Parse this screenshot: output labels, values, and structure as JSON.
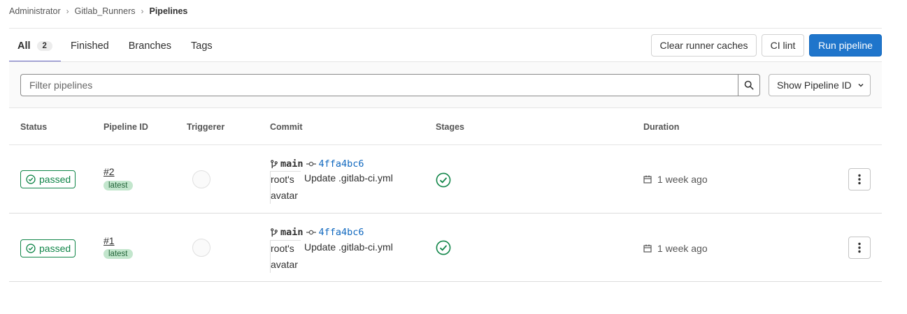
{
  "breadcrumb": [
    "Administrator",
    "Gitlab_Runners",
    "Pipelines"
  ],
  "tabs": [
    {
      "label": "All",
      "count": "2"
    },
    {
      "label": "Finished"
    },
    {
      "label": "Branches"
    },
    {
      "label": "Tags"
    }
  ],
  "buttons": {
    "clear_caches": "Clear runner caches",
    "ci_lint": "CI lint",
    "run_pipeline": "Run pipeline"
  },
  "filter": {
    "placeholder": "Filter pipelines",
    "show_label": "Show Pipeline ID"
  },
  "columns": [
    "Status",
    "Pipeline ID",
    "Triggerer",
    "Commit",
    "Stages",
    "Duration"
  ],
  "pipelines": [
    {
      "status": "passed",
      "id": "#2",
      "tag": "latest",
      "branch": "main",
      "sha": "4ffa4bc6",
      "avatar_alt": "root's avatar",
      "message": "Update .gitlab-ci.yml",
      "finished": "1 week ago"
    },
    {
      "status": "passed",
      "id": "#1",
      "tag": "latest",
      "branch": "main",
      "sha": "4ffa4bc6",
      "avatar_alt": "root's avatar",
      "message": "Update .gitlab-ci.yml",
      "finished": "1 week ago"
    }
  ],
  "colors": {
    "success": "#108548",
    "primary": "#1f75cb",
    "active_tab": "#6666c4",
    "link": "#1068bf"
  }
}
